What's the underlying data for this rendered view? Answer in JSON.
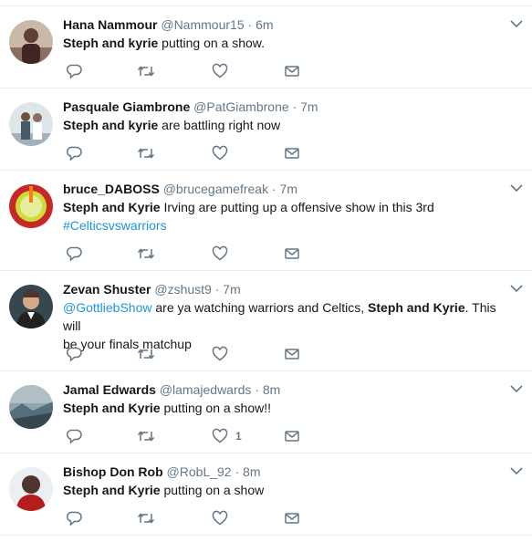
{
  "tweets": [
    {
      "name": "Hana Nammour",
      "handle": "@Nammour15",
      "time": "6m",
      "text_parts": [
        {
          "t": "Steph and kyrie",
          "b": true
        },
        {
          "t": " putting on a show.",
          "b": false
        }
      ],
      "like_count": "",
      "avatar": "person-icon"
    },
    {
      "name": "Pasquale Giambrone",
      "handle": "@PatGiambrone",
      "time": "7m",
      "text_parts": [
        {
          "t": "Steph and kyrie",
          "b": true
        },
        {
          "t": " are battling right now",
          "b": false
        }
      ],
      "like_count": "",
      "avatar": "group-photo-icon"
    },
    {
      "name": "bruce_DABOSS",
      "handle": "@brucegamefreak",
      "time": "7m",
      "text_parts": [
        {
          "t": "Steph and Kyrie",
          "b": true
        },
        {
          "t": " Irving are putting up a offensive show in this 3rd",
          "b": false
        }
      ],
      "link": "#Celticsvswarriors",
      "like_count": "",
      "avatar": "drink-photo-icon"
    },
    {
      "name": "Zevan Shuster",
      "handle": "@zshust9",
      "time": "7m",
      "mention": "@GottliebShow",
      "text_parts": [
        {
          "t": " are ya watching warriors and Celtics, ",
          "b": false
        },
        {
          "t": "Steph and Kyrie",
          "b": true
        },
        {
          "t": ". This will",
          "b": false
        }
      ],
      "text_line2": "be your finals matchup",
      "like_count": "",
      "avatar": "person-icon"
    },
    {
      "name": "Jamal Edwards",
      "handle": "@lamajedwards",
      "time": "8m",
      "text_parts": [
        {
          "t": "Steph and Kyrie",
          "b": true
        },
        {
          "t": " putting on a show!!",
          "b": false
        }
      ],
      "like_count": "1",
      "avatar": "landscape-photo-icon"
    },
    {
      "name": "Bishop Don Rob",
      "handle": "@RobL_92",
      "time": "8m",
      "text_parts": [
        {
          "t": "Steph and Kyrie",
          "b": true
        },
        {
          "t": " putting on a show",
          "b": false
        }
      ],
      "like_count": "",
      "avatar": "person-icon"
    }
  ],
  "separator": "·",
  "colors": {
    "name": "#14171a",
    "secondary": "#657786",
    "link": "#1b95e0",
    "divider": "#e6ecf0"
  },
  "icons": {
    "reply": "reply-icon",
    "retweet": "retweet-icon",
    "like": "heart-icon",
    "dm": "envelope-icon",
    "menu": "chevron-down-icon"
  }
}
